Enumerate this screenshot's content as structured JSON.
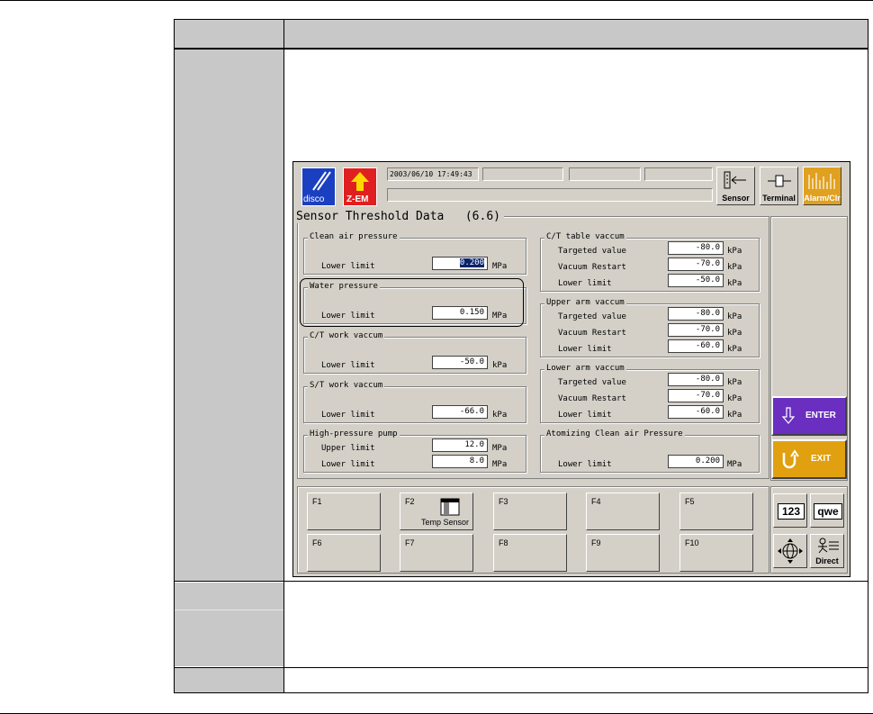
{
  "screen": {
    "status_datetime": "2003/06/10 17:49:43",
    "logo_disco": "disco",
    "logo_zem": "Z-EM",
    "toolbar": {
      "sensor": "Sensor",
      "terminal": "Terminal",
      "alarm": "Alarm/Clr"
    },
    "title": "Sensor Threshold Data",
    "version": "(6.6)",
    "left_groups": [
      {
        "title": "Clean air pressure",
        "rows": [
          {
            "label": "Lower limit",
            "value": "0.200",
            "unit": "MPa",
            "selected": true
          }
        ]
      },
      {
        "title": "Water pressure",
        "rows": [
          {
            "label": "Lower limit",
            "value": "0.150",
            "unit": "MPa"
          }
        ]
      },
      {
        "title": "C/T work vaccum",
        "rows": [
          {
            "label": "Lower limit",
            "value": "-50.0",
            "unit": "kPa"
          }
        ]
      },
      {
        "title": "S/T work vaccum",
        "rows": [
          {
            "label": "Lower limit",
            "value": "-66.0",
            "unit": "kPa"
          }
        ]
      },
      {
        "title": "High-pressure pump",
        "rows": [
          {
            "label": "Upper limit",
            "value": "12.0",
            "unit": "MPa"
          },
          {
            "label": "Lower limit",
            "value": "8.0",
            "unit": "MPa"
          }
        ]
      }
    ],
    "right_groups": [
      {
        "title": "C/T table vaccum",
        "rows": [
          {
            "label": "Targeted value",
            "value": "-80.0",
            "unit": "kPa"
          },
          {
            "label": "Vacuum Restart",
            "value": "-70.0",
            "unit": "kPa"
          },
          {
            "label": "Lower limit",
            "value": "-50.0",
            "unit": "kPa"
          }
        ]
      },
      {
        "title": "Upper arm vaccum",
        "rows": [
          {
            "label": "Targeted value",
            "value": "-80.0",
            "unit": "kPa"
          },
          {
            "label": "Vacuum Restart",
            "value": "-70.0",
            "unit": "kPa"
          },
          {
            "label": "Lower limit",
            "value": "-60.0",
            "unit": "kPa"
          }
        ]
      },
      {
        "title": "Lower arm vaccum",
        "rows": [
          {
            "label": "Targeted value",
            "value": "-80.0",
            "unit": "kPa"
          },
          {
            "label": "Vacuum Restart",
            "value": "-70.0",
            "unit": "kPa"
          },
          {
            "label": "Lower limit",
            "value": "-60.0",
            "unit": "kPa"
          }
        ]
      },
      {
        "title": "Atomizing Clean air Pressure",
        "rows": [
          {
            "label": "Lower limit",
            "value": "0.200",
            "unit": "MPa"
          }
        ]
      }
    ],
    "enter": "ENTER",
    "exit": "EXIT",
    "fkeys_row1": [
      "F1",
      "F2",
      "F3",
      "F4",
      "F5"
    ],
    "fkeys_row2": [
      "F6",
      "F7",
      "F8",
      "F9",
      "F10"
    ],
    "f2_sub": "Temp Sensor",
    "kb_num": "123",
    "kb_alpha": "qwe",
    "direct": "Direct"
  },
  "colors": {
    "disco": "#1a3fc0",
    "zem": "#e02020",
    "enter": "#6a2fc0",
    "exit": "#e0a010",
    "alarm": "#e0a020",
    "page_gray": "#c8c8c8"
  }
}
